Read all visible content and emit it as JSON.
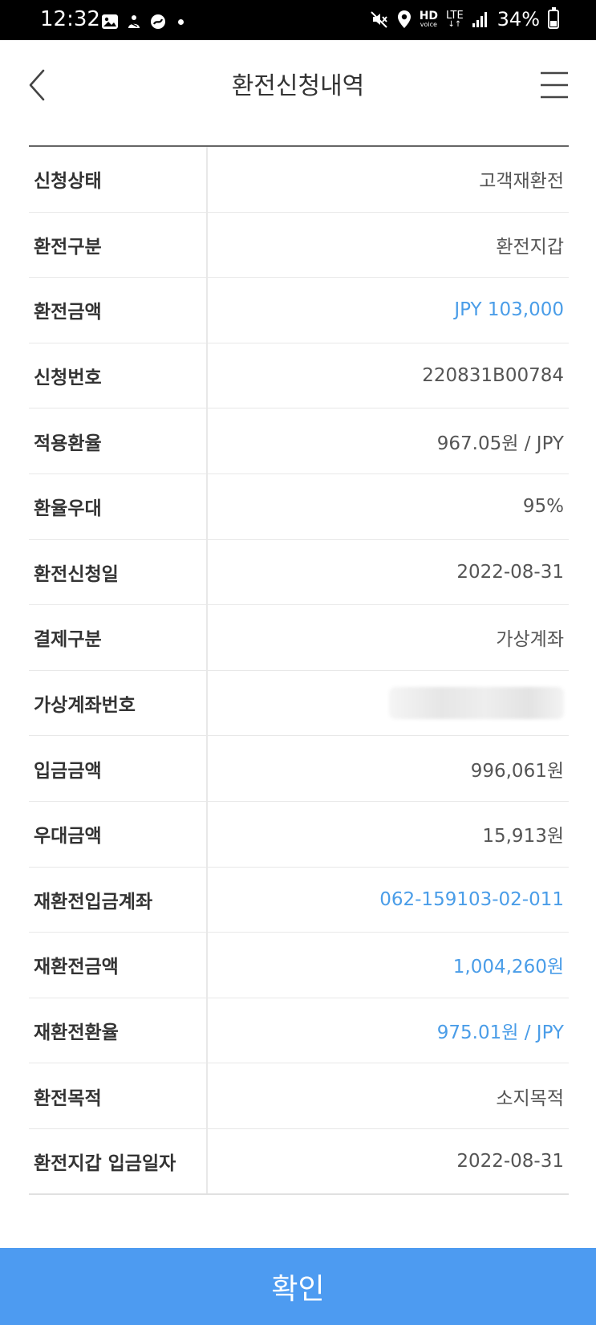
{
  "status_bar": {
    "time": "12:32",
    "hd": "HD",
    "hd_sub": "voice",
    "lte": "LTE",
    "battery_text": "34%",
    "battery_level": 0.34,
    "icons": [
      "gallery-icon",
      "notification-icon",
      "app-icon",
      "mute-icon",
      "location-icon",
      "signal-icon",
      "battery-icon"
    ]
  },
  "header": {
    "title": "환전신청내역"
  },
  "rows": [
    {
      "label": "신청상태",
      "value": "고객재환전"
    },
    {
      "label": "환전구분",
      "value": "환전지갑"
    },
    {
      "label": "환전금액",
      "value": "JPY 103,000"
    },
    {
      "label": "신청번호",
      "value": "220831B00784"
    },
    {
      "label": "적용환율",
      "value": "967.05원 / JPY"
    },
    {
      "label": "환율우대",
      "value": "95%"
    },
    {
      "label": "환전신청일",
      "value": "2022-08-31"
    },
    {
      "label": "결제구분",
      "value": "가상계좌"
    },
    {
      "label": "가상계좌번호",
      "value": ""
    },
    {
      "label": "입금금액",
      "value": "996,061원"
    },
    {
      "label": "우대금액",
      "value": "15,913원"
    },
    {
      "label": "재환전입금계좌",
      "value": "062-159103-02-011"
    },
    {
      "label": "재환전금액",
      "value": "1,004,260원"
    },
    {
      "label": "재환전환율",
      "value": "975.01원 / JPY"
    },
    {
      "label": "환전목적",
      "value": "소지목적"
    },
    {
      "label": "환전지갑 입금일자",
      "value": "2022-08-31"
    }
  ],
  "colors": {
    "accent_blue": "#4a9de8",
    "button_blue": "#4d9bf1"
  },
  "confirm_button": {
    "label": "확인"
  }
}
